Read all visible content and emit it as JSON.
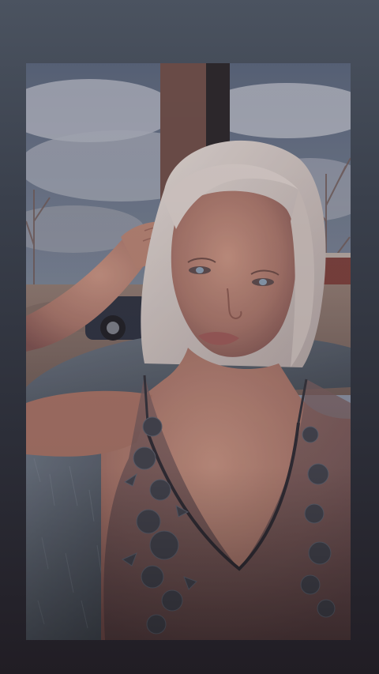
{
  "story": {
    "background_top": "#4b5360",
    "background_bottom": "#211d24"
  },
  "photo": {
    "subject": "photo",
    "palette": {
      "sky": "#7d8a9c",
      "cloud": "#b9bfca",
      "skin": "#b88474",
      "skin_shadow": "#8a5a50",
      "hair": "#d8cfc9",
      "fur": "#56616c",
      "lace": "#3f434d",
      "garment": "#6d5457",
      "window_frame": "#6b4d47"
    }
  }
}
